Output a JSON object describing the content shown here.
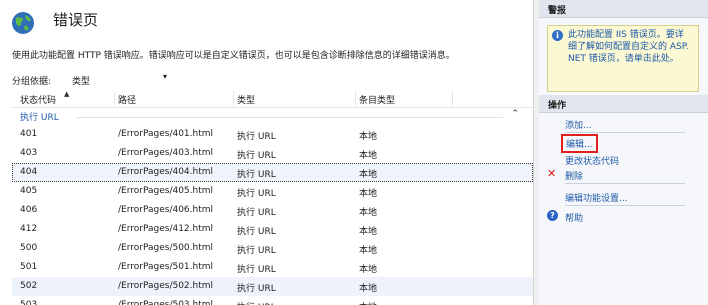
{
  "main": {
    "title": "错误页",
    "description": "使用此功能配置 HTTP 错误响应。错误响应可以是自定义错误页，也可以是包含诊断排除信息的详细错误消息。",
    "group_by_label": "分组依据:",
    "group_by_value": "类型",
    "columns": [
      "状态代码",
      "路径",
      "类型",
      "条目类型"
    ],
    "group_name": "执行 URL",
    "rows": [
      [
        "401",
        "/ErrorPages/401.html",
        "执行 URL",
        "本地"
      ],
      [
        "403",
        "/ErrorPages/403.html",
        "执行 URL",
        "本地"
      ],
      [
        "404",
        "/ErrorPages/404.html",
        "执行 URL",
        "本地"
      ],
      [
        "405",
        "/ErrorPages/405.html",
        "执行 URL",
        "本地"
      ],
      [
        "406",
        "/ErrorPages/406.html",
        "执行 URL",
        "本地"
      ],
      [
        "412",
        "/ErrorPages/412.html",
        "执行 URL",
        "本地"
      ],
      [
        "500",
        "/ErrorPages/500.html",
        "执行 URL",
        "本地"
      ],
      [
        "501",
        "/ErrorPages/501.html",
        "执行 URL",
        "本地"
      ],
      [
        "502",
        "/ErrorPages/502.html",
        "执行 URL",
        "本地"
      ],
      [
        "503",
        "/ErrorPages/503.html",
        "执行 URL",
        "本地"
      ]
    ],
    "selected_row": "404"
  },
  "sidebar": {
    "alerts_header": "警报",
    "alert_text": "此功能配置 IIS 错误页。要详细了解如何配置自定义的 ASP.NET 错误页，请单击此处。",
    "actions_header": "操作",
    "actions": {
      "add": "添加...",
      "edit": "编辑...",
      "change_status_code": "更改状态代码",
      "delete": "删除",
      "edit_feature_settings": "编辑功能设置...",
      "help": "帮助"
    }
  },
  "colors": {
    "link": "#1e5aa8",
    "highlight_box": "#e0211b",
    "alert_background": "#fbf8d4",
    "delete_icon": "#d01818"
  }
}
